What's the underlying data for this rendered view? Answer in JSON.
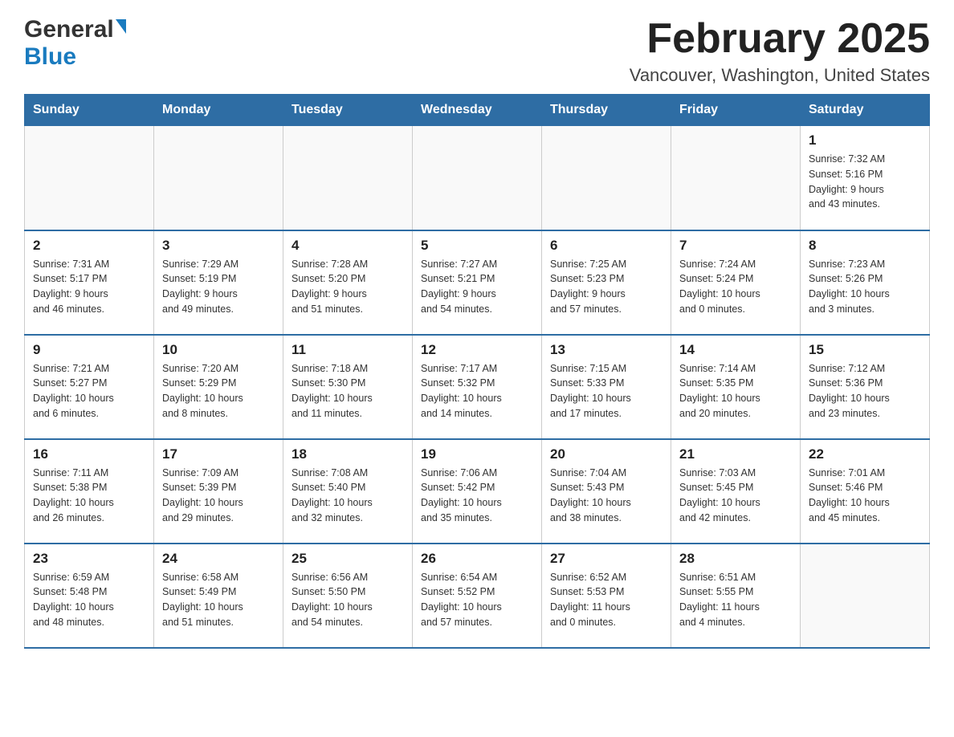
{
  "header": {
    "logo_general": "General",
    "logo_blue": "Blue",
    "month_title": "February 2025",
    "location": "Vancouver, Washington, United States"
  },
  "weekdays": [
    "Sunday",
    "Monday",
    "Tuesday",
    "Wednesday",
    "Thursday",
    "Friday",
    "Saturday"
  ],
  "weeks": [
    [
      {
        "day": "",
        "info": ""
      },
      {
        "day": "",
        "info": ""
      },
      {
        "day": "",
        "info": ""
      },
      {
        "day": "",
        "info": ""
      },
      {
        "day": "",
        "info": ""
      },
      {
        "day": "",
        "info": ""
      },
      {
        "day": "1",
        "info": "Sunrise: 7:32 AM\nSunset: 5:16 PM\nDaylight: 9 hours\nand 43 minutes."
      }
    ],
    [
      {
        "day": "2",
        "info": "Sunrise: 7:31 AM\nSunset: 5:17 PM\nDaylight: 9 hours\nand 46 minutes."
      },
      {
        "day": "3",
        "info": "Sunrise: 7:29 AM\nSunset: 5:19 PM\nDaylight: 9 hours\nand 49 minutes."
      },
      {
        "day": "4",
        "info": "Sunrise: 7:28 AM\nSunset: 5:20 PM\nDaylight: 9 hours\nand 51 minutes."
      },
      {
        "day": "5",
        "info": "Sunrise: 7:27 AM\nSunset: 5:21 PM\nDaylight: 9 hours\nand 54 minutes."
      },
      {
        "day": "6",
        "info": "Sunrise: 7:25 AM\nSunset: 5:23 PM\nDaylight: 9 hours\nand 57 minutes."
      },
      {
        "day": "7",
        "info": "Sunrise: 7:24 AM\nSunset: 5:24 PM\nDaylight: 10 hours\nand 0 minutes."
      },
      {
        "day": "8",
        "info": "Sunrise: 7:23 AM\nSunset: 5:26 PM\nDaylight: 10 hours\nand 3 minutes."
      }
    ],
    [
      {
        "day": "9",
        "info": "Sunrise: 7:21 AM\nSunset: 5:27 PM\nDaylight: 10 hours\nand 6 minutes."
      },
      {
        "day": "10",
        "info": "Sunrise: 7:20 AM\nSunset: 5:29 PM\nDaylight: 10 hours\nand 8 minutes."
      },
      {
        "day": "11",
        "info": "Sunrise: 7:18 AM\nSunset: 5:30 PM\nDaylight: 10 hours\nand 11 minutes."
      },
      {
        "day": "12",
        "info": "Sunrise: 7:17 AM\nSunset: 5:32 PM\nDaylight: 10 hours\nand 14 minutes."
      },
      {
        "day": "13",
        "info": "Sunrise: 7:15 AM\nSunset: 5:33 PM\nDaylight: 10 hours\nand 17 minutes."
      },
      {
        "day": "14",
        "info": "Sunrise: 7:14 AM\nSunset: 5:35 PM\nDaylight: 10 hours\nand 20 minutes."
      },
      {
        "day": "15",
        "info": "Sunrise: 7:12 AM\nSunset: 5:36 PM\nDaylight: 10 hours\nand 23 minutes."
      }
    ],
    [
      {
        "day": "16",
        "info": "Sunrise: 7:11 AM\nSunset: 5:38 PM\nDaylight: 10 hours\nand 26 minutes."
      },
      {
        "day": "17",
        "info": "Sunrise: 7:09 AM\nSunset: 5:39 PM\nDaylight: 10 hours\nand 29 minutes."
      },
      {
        "day": "18",
        "info": "Sunrise: 7:08 AM\nSunset: 5:40 PM\nDaylight: 10 hours\nand 32 minutes."
      },
      {
        "day": "19",
        "info": "Sunrise: 7:06 AM\nSunset: 5:42 PM\nDaylight: 10 hours\nand 35 minutes."
      },
      {
        "day": "20",
        "info": "Sunrise: 7:04 AM\nSunset: 5:43 PM\nDaylight: 10 hours\nand 38 minutes."
      },
      {
        "day": "21",
        "info": "Sunrise: 7:03 AM\nSunset: 5:45 PM\nDaylight: 10 hours\nand 42 minutes."
      },
      {
        "day": "22",
        "info": "Sunrise: 7:01 AM\nSunset: 5:46 PM\nDaylight: 10 hours\nand 45 minutes."
      }
    ],
    [
      {
        "day": "23",
        "info": "Sunrise: 6:59 AM\nSunset: 5:48 PM\nDaylight: 10 hours\nand 48 minutes."
      },
      {
        "day": "24",
        "info": "Sunrise: 6:58 AM\nSunset: 5:49 PM\nDaylight: 10 hours\nand 51 minutes."
      },
      {
        "day": "25",
        "info": "Sunrise: 6:56 AM\nSunset: 5:50 PM\nDaylight: 10 hours\nand 54 minutes."
      },
      {
        "day": "26",
        "info": "Sunrise: 6:54 AM\nSunset: 5:52 PM\nDaylight: 10 hours\nand 57 minutes."
      },
      {
        "day": "27",
        "info": "Sunrise: 6:52 AM\nSunset: 5:53 PM\nDaylight: 11 hours\nand 0 minutes."
      },
      {
        "day": "28",
        "info": "Sunrise: 6:51 AM\nSunset: 5:55 PM\nDaylight: 11 hours\nand 4 minutes."
      },
      {
        "day": "",
        "info": ""
      }
    ]
  ]
}
